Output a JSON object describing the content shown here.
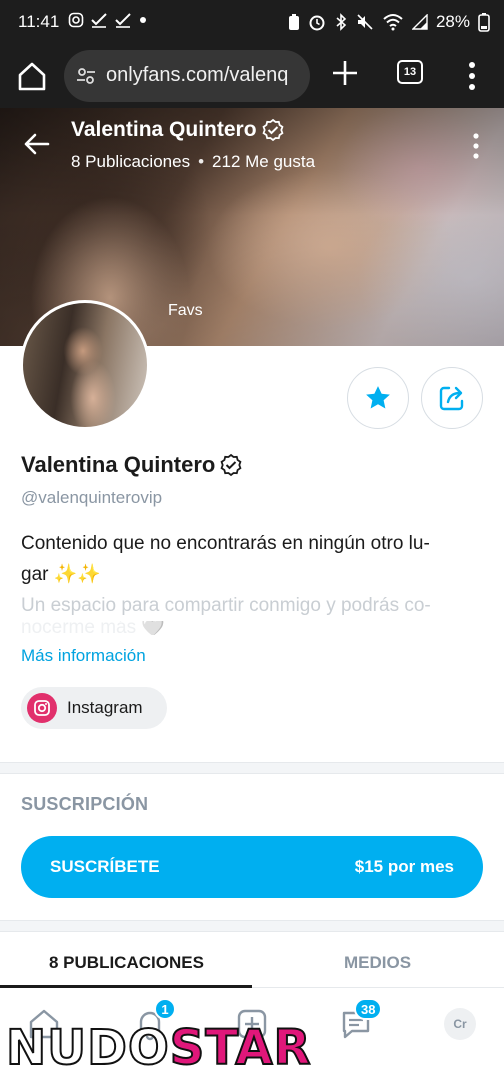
{
  "status_bar": {
    "time": "11:41",
    "left_icons": [
      "instagram-icon",
      "check-icon",
      "check-icon",
      "dot-icon"
    ],
    "right_icons": [
      "battery-saver-icon",
      "alarm-icon",
      "bluetooth-icon",
      "mute-icon",
      "wifi-icon",
      "signal-icon"
    ],
    "battery": "28%"
  },
  "browser": {
    "url": "onlyfans.com/valenq",
    "tab_count": "13"
  },
  "cover": {
    "name": "Valentina Quintero",
    "posts": "8 Publicaciones",
    "separator": "•",
    "likes": "212 Me gusta",
    "favs_label": "Favs"
  },
  "profile": {
    "display_name": "Valentina Quintero",
    "username": "@valenquinterovip",
    "bio_line1": "Contenido que no encontrarás en ningún otro lu-",
    "bio_line2": "gar ✨✨",
    "bio_line3": "Un espacio para compartir conmigo y podrás co-",
    "bio_line4": "nocerme más 🤍",
    "more_info": "Más información",
    "social_link": "Instagram"
  },
  "subscription": {
    "heading": "SUSCRIPCIÓN",
    "button_label": "SUSCRÍBETE",
    "price": "$15 por mes"
  },
  "tabs": {
    "posts": "8 PUBLICACIONES",
    "media": "MEDIOS"
  },
  "bottom_nav": {
    "notif_badge": "1",
    "msg_badge": "38",
    "avatar_initials": "Cr"
  },
  "watermark": {
    "part1": "NUDO",
    "part2": "STAR"
  },
  "colors": {
    "accent": "#00aff0",
    "link": "#00a3e0",
    "muted": "#8a96a3",
    "instagram": "#e1306c"
  }
}
